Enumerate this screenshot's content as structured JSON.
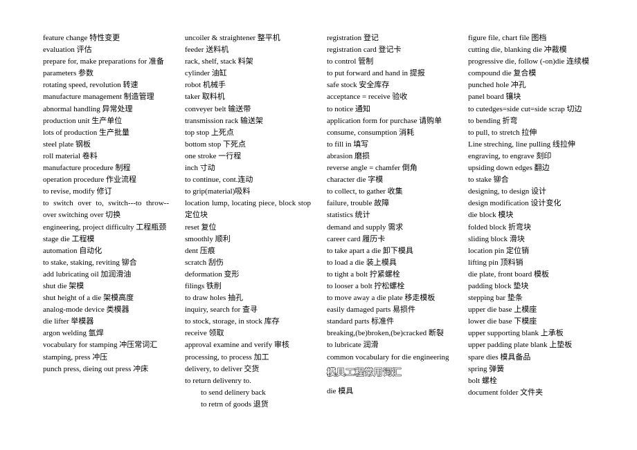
{
  "columns": [
    {
      "entries": [
        "feature change 特性变更",
        "evaluation 评估",
        "prepare for, make preparations for 准备",
        "parameters 参数",
        "rotating speed, revolution 转速",
        "manufacture management 制造管理",
        "abnormal handling 异常处理",
        "production unit 生产单位",
        "lots of production 生产批量",
        "steel plate 钢板",
        "roll material 卷料",
        "manufacture procedure 制程",
        "operation procedure 作业流程",
        "to revise, modify 修订",
        "to switch over to, switch---to throw--over switching over 切换",
        "engineering, project difficulty 工程瓶颈",
        "stage die 工程模",
        "automation 自动化",
        "to stake, staking, reviting 铆合",
        "add lubricating oil 加润滑油",
        "shut die 架模",
        "shut height of a die 架模高度",
        "analog-mode device 类模器",
        "die lifter 举模器",
        "argon welding 氩焊",
        "vocabulary for stamping 冲压常词汇",
        "stamping, press 冲压",
        "punch press, dieing out press 冲床"
      ]
    },
    {
      "entries": [
        "uncoiler & straightener 整平机",
        "feeder 送料机",
        "rack, shelf, stack 料架",
        "cylinder 油缸",
        "robot 机械手",
        "taker 取料机",
        "conveyer belt 输送带",
        "transmission rack 输送架",
        "top stop 上死点",
        "bottom stop 下死点",
        "one stroke 一行程",
        "inch 寸动",
        "to continue, cont.连动",
        "to grip(material)吸料",
        "location lump, locating piece, block stop 定位块",
        "reset 复位",
        "smoothly 顺利",
        "dent 压痕",
        "scratch 刮伤",
        "deformation 变形",
        "filings 铁削",
        "to draw holes 抽孔",
        "inquiry, search for 查寻",
        "to stock, storage, in stock 库存",
        "receive 领取",
        "approval examine and verify 审核",
        "processing, to process 加工",
        "delivery, to deliver 交货",
        "to return delivenry to."
      ],
      "indented_entries": [
        "to send delinery back",
        "to retrn of goods 退货"
      ]
    },
    {
      "entries": [
        "registration 登记",
        "registration card 登记卡",
        "to control 管制",
        "to put forward and hand in 提报",
        "safe stock 安全库存",
        "acceptance = receive 验收",
        "to notice 通知",
        "application form for purchase 请购单",
        "consume, consumption 消耗",
        "to fill in 填写",
        "abrasion 磨损",
        "reverse angle = chamfer 倒角",
        "character die 字模",
        "to collect, to gather 收集",
        "failure, trouble 故障",
        "statistics 统计",
        "demand and supply 需求",
        "career card 履历卡",
        "to take apart a die 卸下模具",
        "to load a die 装上模具",
        "to tight a bolt 拧紧螺栓",
        "to looser a bolt 拧松螺栓",
        "to move away a die plate 移走模板",
        "easily damaged parts 易损件",
        "standard parts 标准件",
        "breaking,(be)broken,(be)cracked 断裂",
        "to lubricate 润滑",
        "common vocabulary for die engineering"
      ],
      "heading": "模具工程常用词汇",
      "after_heading": [
        "die 模具"
      ]
    },
    {
      "entries": [
        "figure file, chart file 图档",
        "cutting die, blanking die 冲裁模",
        "progressive die, follow (-on)die 连续模",
        "compound die 复合模",
        "punched hole 冲孔",
        "panel board 镶块",
        "to cutedges=side cut=side scrap 切边",
        "to bending 折弯",
        "to pull, to stretch 拉伸",
        "Line streching, line pulling 线拉伸",
        "engraving, to engrave 刻印",
        "upsiding down edges 翻边",
        "to stake 铆合",
        "designing, to design 设计",
        "design modification 设计变化",
        "die block 模块",
        "folded block 折弯块",
        "sliding block 滑块",
        "location pin 定位销",
        "lifting pin 顶料销",
        "die plate, front board 模板",
        "padding block 垫块",
        "stepping bar 垫条",
        "upper die base 上模座",
        "lower die base 下模座",
        "upper supporting blank 上承板",
        "upper padding plate blank 上垫板",
        "spare dies 模具备品",
        "spring 弹簧",
        "bolt 螺栓",
        "document folder 文件夹"
      ]
    }
  ]
}
